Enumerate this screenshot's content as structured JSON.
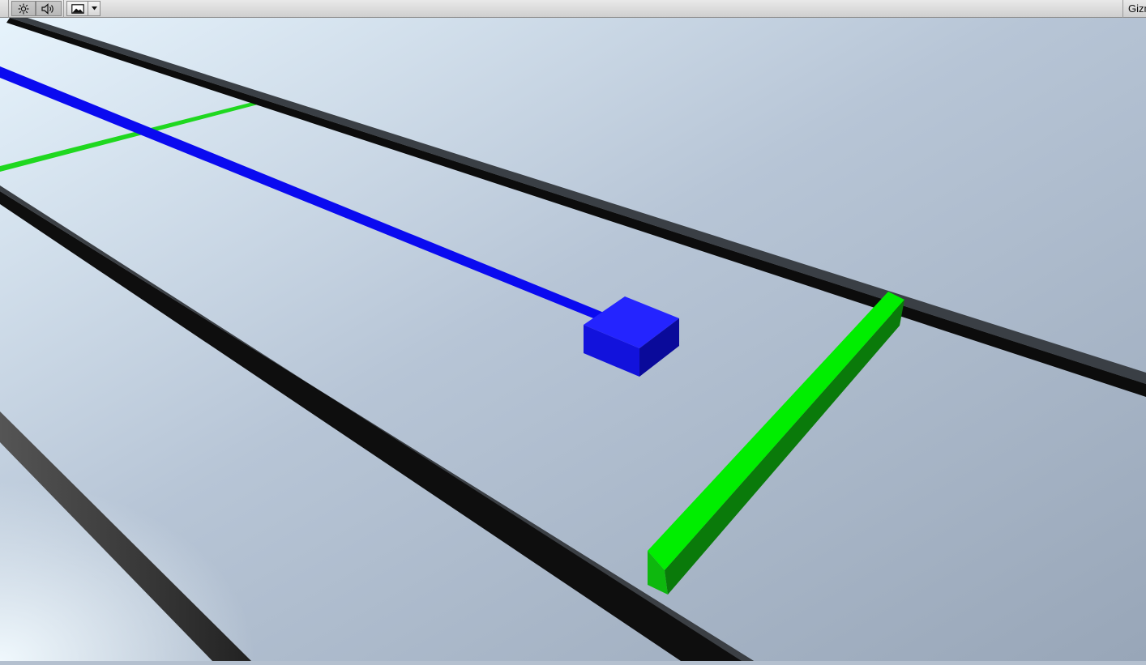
{
  "toolbar": {
    "lighting_icon": "sun-icon",
    "audio_icon": "speaker-icon",
    "effects_icon": "image-icon",
    "effects_dropdown_icon": "triangle-down-icon",
    "gizmos_label": "Gizmos"
  },
  "scene": {
    "background_colors": [
      "#e3f1fb",
      "#b4c2d4",
      "#9aa8ba"
    ],
    "objects": [
      {
        "name": "black-rail",
        "color": "#111111"
      },
      {
        "name": "blue-line",
        "color": "#0000ff"
      },
      {
        "name": "blue-cube",
        "color": "#1212e6"
      },
      {
        "name": "green-beam",
        "color": "#00e000"
      },
      {
        "name": "thin-green-line",
        "color": "#22dd22"
      }
    ]
  }
}
